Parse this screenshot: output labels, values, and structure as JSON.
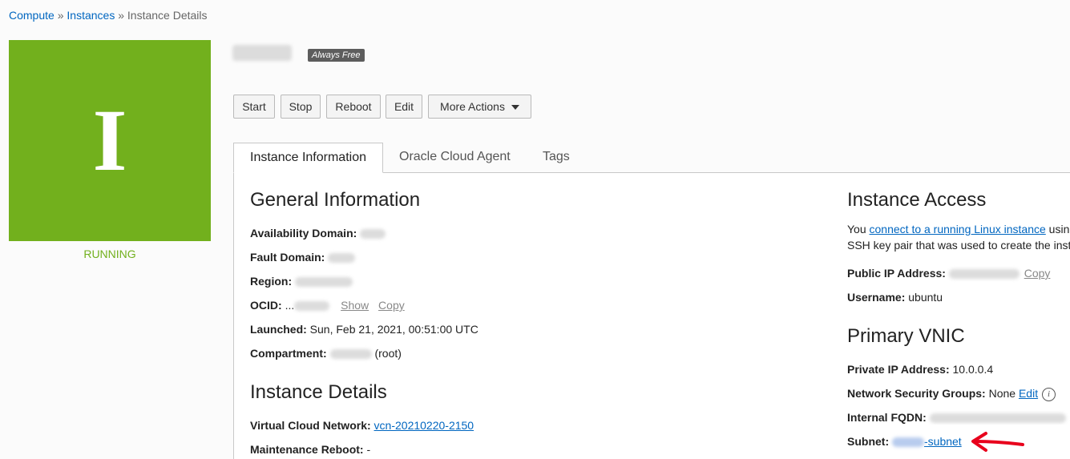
{
  "breadcrumb": {
    "compute": "Compute",
    "sep1": "»",
    "instances": "Instances",
    "sep2": "»",
    "current": "Instance Details"
  },
  "instance": {
    "state_letter": "I",
    "state": "RUNNING",
    "badge": "Always Free"
  },
  "actions": {
    "start": "Start",
    "stop": "Stop",
    "reboot": "Reboot",
    "edit": "Edit",
    "more": "More Actions"
  },
  "tabs": [
    "Instance Information",
    "Oracle Cloud Agent",
    "Tags"
  ],
  "general": {
    "title": "General Information",
    "availability_domain": "Availability Domain:",
    "fault_domain": "Fault Domain:",
    "region": "Region:",
    "ocid_label": "OCID:",
    "ocid_prefix": "...",
    "show": "Show",
    "copy": "Copy",
    "launched_label": "Launched:",
    "launched_value": "Sun, Feb 21, 2021, 00:51:00 UTC",
    "compartment_label": "Compartment:",
    "compartment_suffix": "(root)"
  },
  "details": {
    "title": "Instance Details",
    "vcn_label": "Virtual Cloud Network:",
    "vcn_value": "vcn-20210220-2150",
    "maintenance_label": "Maintenance Reboot:",
    "maintenance_value": "-"
  },
  "access": {
    "title": "Instance Access",
    "text_prefix": "You",
    "link": "connect to a running Linux instance",
    "text_suffix": "usin",
    "text_line2": "SSH key pair that was used to create the inst",
    "public_ip_label": "Public IP Address:",
    "copy": "Copy",
    "username_label": "Username:",
    "username_value": "ubuntu"
  },
  "vnic": {
    "title": "Primary VNIC",
    "private_ip_label": "Private IP Address:",
    "private_ip_value": "10.0.0.4",
    "nsg_label": "Network Security Groups:",
    "nsg_value": "None",
    "nsg_edit": "Edit",
    "info_icon": "i",
    "fqdn_label": "Internal FQDN:",
    "subnet_label": "Subnet:",
    "subnet_suffix": "-subnet"
  },
  "colors": {
    "running": "#72b01d",
    "link": "#0066c0",
    "arrow": "#e8001c"
  }
}
